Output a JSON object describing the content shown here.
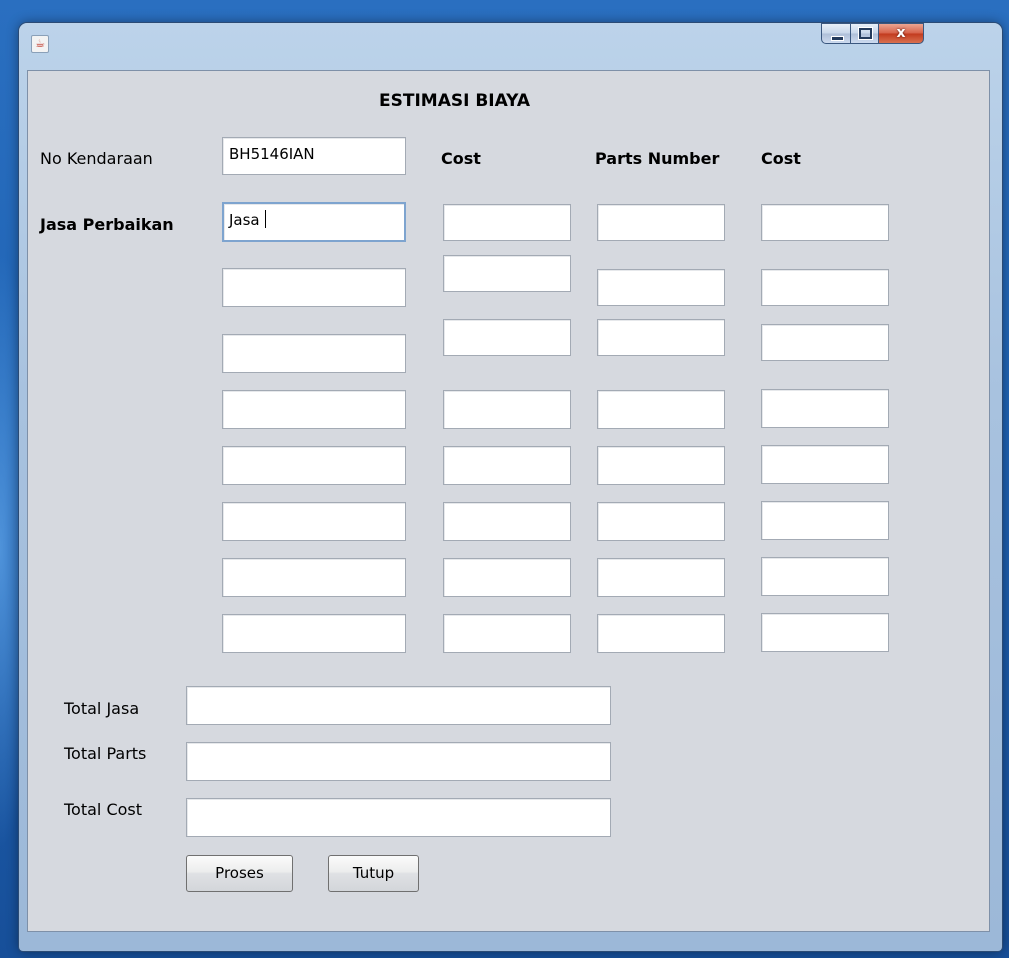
{
  "window": {
    "title": "",
    "controls": {
      "minimize": "minimize-icon",
      "maximize": "maximize-icon",
      "close": "x"
    }
  },
  "form": {
    "heading": "ESTIMASI BIAYA",
    "no_kendaraan_label": "No Kendaraan",
    "no_kendaraan_value": "BH5146IAN",
    "jasa_perbaikan_label": "Jasa Perbaikan",
    "columns": {
      "cost1": "Cost",
      "parts_number": "Parts Number",
      "cost2": "Cost"
    },
    "rows": [
      {
        "jasa": "Jasa",
        "cost": "",
        "parts_number": "",
        "part_cost": ""
      },
      {
        "jasa": "",
        "cost": "",
        "parts_number": "",
        "part_cost": ""
      },
      {
        "jasa": "",
        "cost": "",
        "parts_number": "",
        "part_cost": ""
      },
      {
        "jasa": "",
        "cost": "",
        "parts_number": "",
        "part_cost": ""
      },
      {
        "jasa": "",
        "cost": "",
        "parts_number": "",
        "part_cost": ""
      },
      {
        "jasa": "",
        "cost": "",
        "parts_number": "",
        "part_cost": ""
      },
      {
        "jasa": "",
        "cost": "",
        "parts_number": "",
        "part_cost": ""
      },
      {
        "jasa": "",
        "cost": "",
        "parts_number": "",
        "part_cost": ""
      }
    ],
    "totals": {
      "total_jasa_label": "Total Jasa",
      "total_jasa_value": "",
      "total_parts_label": "Total Parts",
      "total_parts_value": "",
      "total_cost_label": "Total Cost",
      "total_cost_value": ""
    },
    "buttons": {
      "proses": "Proses",
      "tutup": "Tutup"
    }
  }
}
